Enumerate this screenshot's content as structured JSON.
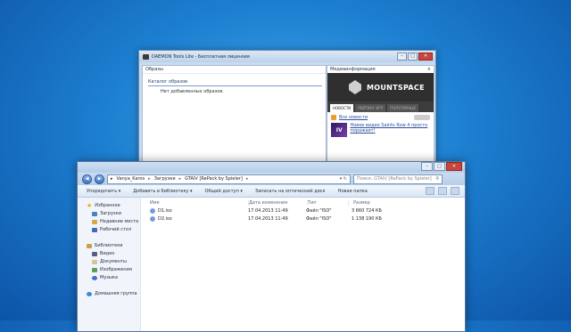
{
  "daemon": {
    "title": "DAEMON Tools Lite - Бесплатная лицензия",
    "images_header": "Образы",
    "catalog_label": "Каталог образов",
    "empty_text": "Нет добавленных образов.",
    "media_header": "Медиаинформация",
    "brand": "MOUNTSPACE",
    "tabs": [
      "НОВОСТИ",
      "РЕЙТИНГ ИГР",
      "ПОПУЛЯРНЫЕ"
    ],
    "all_news": "Все новости",
    "news_text": "Новое видео Saints Row 4 просто поражает!",
    "news_thumb": "IV"
  },
  "explorer": {
    "breadcrumb": [
      "Vanya_Karos",
      "Загрузки",
      "GTAIV [RePack by Spieler]"
    ],
    "search_placeholder": "Поиск: GTAIV [RePack by Spieler]",
    "toolbar": [
      "Упорядочить ▾",
      "Добавить в библиотеку ▾",
      "Общий доступ ▾",
      "Записать на оптический диск",
      "Новая папка"
    ],
    "nav": {
      "favorites": "Избранное",
      "fav_items": [
        "Загрузки",
        "Недавние места",
        "Рабочий стол"
      ],
      "libraries": "Библиотеки",
      "lib_items": [
        "Видео",
        "Документы",
        "Изображения",
        "Музыка"
      ],
      "homegroup": "Домашняя группа"
    },
    "columns": [
      "Имя",
      "Дата изменения",
      "Тип",
      "Размер"
    ],
    "files": [
      {
        "name": "D1.iso",
        "date": "17.04.2013 11:49",
        "type": "Файл \"ISO\"",
        "size": "3 660 724 КБ"
      },
      {
        "name": "D2.iso",
        "date": "17.04.2013 11:49",
        "type": "Файл \"ISO\"",
        "size": "1 138 190 КБ"
      }
    ]
  }
}
